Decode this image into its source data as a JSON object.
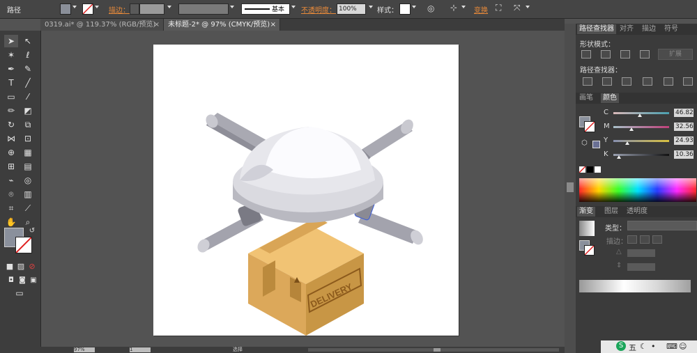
{
  "controlbar": {
    "selection_label": "路径",
    "stroke_label": "描边：",
    "stroke_profile": "基本",
    "opacity_label": "不透明度：",
    "opacity_value": "100%",
    "style_label": "样式：",
    "transform_label": "变换"
  },
  "tabs": [
    {
      "label": "0319.ai* @ 119.37% (RGB/预览)"
    },
    {
      "label": "未标题-2* @ 97% (CMYK/预览)"
    }
  ],
  "tab_close": "×",
  "artwork": {
    "box_text": "DELIVERY"
  },
  "statusbar": {
    "zoom": "97%",
    "page": "1",
    "mode": "选择"
  },
  "pathfinder": {
    "tabs": [
      "路径查找器",
      "对齐",
      "描边",
      "符号"
    ],
    "shape_modes": "形状模式：",
    "expand": "扩展",
    "pathfinders": "路径查找器："
  },
  "color_panel": {
    "tabs": [
      "画笔",
      "颜色"
    ],
    "channels": [
      {
        "label": "C",
        "value": "46.82",
        "pos": 0.47
      },
      {
        "label": "M",
        "value": "32.56",
        "pos": 0.33
      },
      {
        "label": "Y",
        "value": "24.93",
        "pos": 0.25
      },
      {
        "label": "K",
        "value": "10.36",
        "pos": 0.1
      }
    ],
    "percent": "%"
  },
  "gradient_panel": {
    "tabs": [
      "渐变",
      "图层",
      "透明度"
    ],
    "type_label": "类型：",
    "stroke_label": "描边："
  },
  "taskbar": {
    "ime": "五"
  }
}
